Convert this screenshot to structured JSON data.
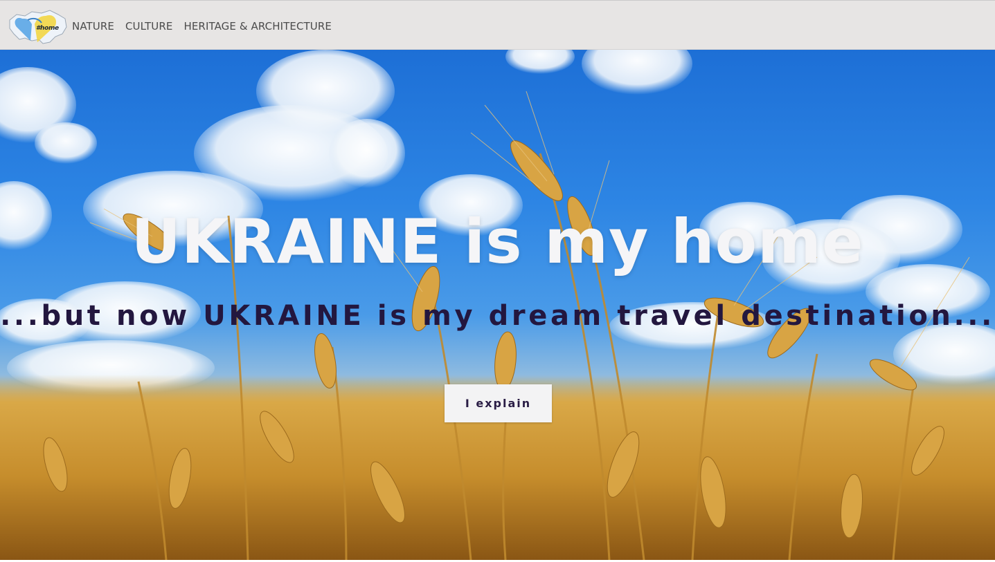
{
  "header": {
    "logo_text": "#home",
    "nav": [
      {
        "label": "NATURE"
      },
      {
        "label": "CULTURE"
      },
      {
        "label": "HERITAGE & ARCHITECTURE"
      }
    ]
  },
  "hero": {
    "title": "UKRAINE is my home",
    "subtitle": "...but now UKRAINE is my dream travel destination...",
    "button_label": "I explain"
  },
  "colors": {
    "header_bg": "#e7e5e4",
    "title": "#f5f5f7",
    "subtitle": "#23173f",
    "button_bg": "#f3f3f4",
    "sky": "#1d6fd6",
    "wheat": "#d09a35"
  }
}
